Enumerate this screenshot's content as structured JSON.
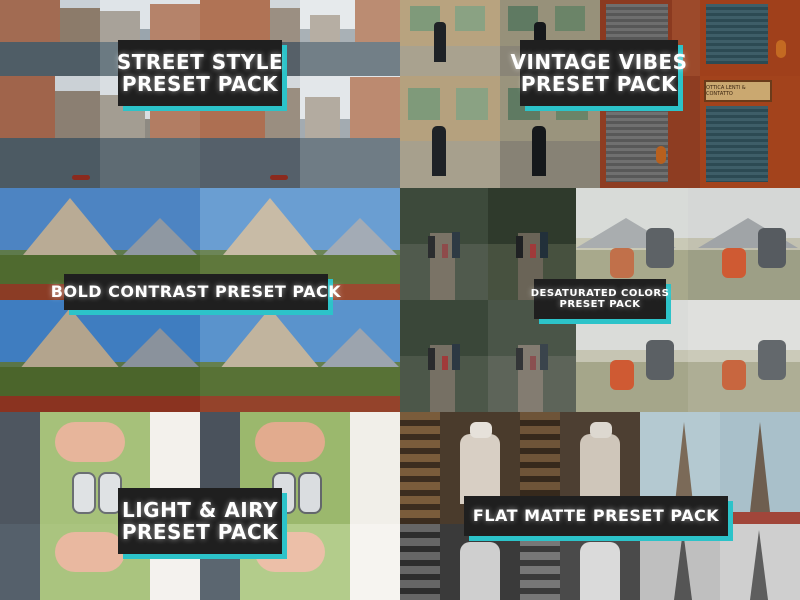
{
  "labels": {
    "street_style": [
      "STREET STYLE",
      "PRESET PACK"
    ],
    "vintage_vibes": [
      "VINTAGE VIBES",
      "PRESET PACK"
    ],
    "bold_contrast": [
      "BOLD CONTRAST PRESET PACK"
    ],
    "desaturated_colors": [
      "DESATURATED COLORS",
      "PRESET PACK"
    ],
    "light_airy": [
      "LIGHT & AIRY",
      "PRESET PACK"
    ],
    "flat_matte": [
      "FLAT MATTE PRESET PACK"
    ]
  },
  "colors": {
    "label_background": "#1f1f1f",
    "label_text": "#ffffff",
    "label_accent_shadow": "#2cc3c9"
  },
  "shop_sign": "OTTICA LENTI & CONTATTO"
}
